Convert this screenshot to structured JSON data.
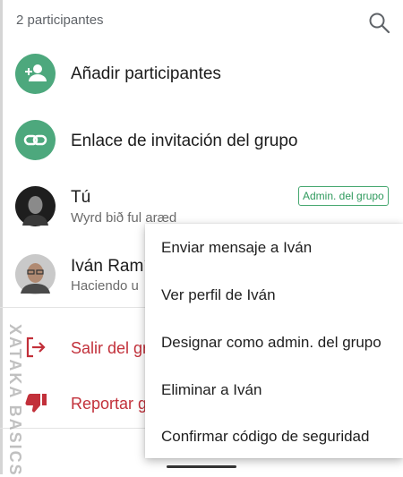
{
  "header": {
    "participants_count": "2 participantes"
  },
  "actions_top": [
    {
      "label": "Añadir participantes",
      "icon": "add-person-icon"
    },
    {
      "label": "Enlace de invitación del grupo",
      "icon": "link-icon"
    }
  ],
  "participants": [
    {
      "name": "Tú",
      "status": "Wyrd bið ful aræd",
      "badge": "Admin. del grupo"
    },
    {
      "name": "Iván Ramí",
      "status": "Haciendo u"
    }
  ],
  "actions_bottom": [
    {
      "label": "Salir del gru",
      "icon": "exit-icon"
    },
    {
      "label": "Reportar g",
      "icon": "thumb-down-icon"
    }
  ],
  "context_menu": {
    "items": [
      "Enviar mensaje a Iván",
      "Ver perfil de Iván",
      "Designar como admin. del grupo",
      "Eliminar a Iván",
      "Confirmar código de seguridad"
    ]
  },
  "watermark": "XATAKA BASICS",
  "colors": {
    "accent_green": "#4da87d",
    "danger_red": "#c2303a"
  }
}
